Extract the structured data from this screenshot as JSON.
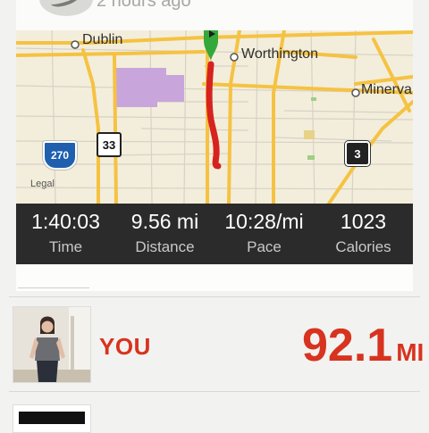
{
  "feed_item": {
    "time_ago": "2 hours ago"
  },
  "map": {
    "labels": {
      "dublin": "Dublin",
      "worthington": "Worthington",
      "minerva": "Minerva",
      "legal": "Legal"
    },
    "shields": {
      "i270": "270",
      "us33": "33",
      "route3": "3"
    },
    "colors": {
      "route": "#d62320",
      "start_pin": "#34a83a",
      "major_road": "#f5c242",
      "minor_road": "#c9c6bd",
      "park": "#c8a6db",
      "land": "#f3eedb"
    }
  },
  "stats": [
    {
      "value": "1:40:03",
      "label": "Time"
    },
    {
      "value": "9.56 mi",
      "label": "Distance"
    },
    {
      "value": "10:28/mi",
      "label": "Pace"
    },
    {
      "value": "1023",
      "label": "Calories"
    }
  ],
  "leaderboard": {
    "user_label": "YOU",
    "distance_value": "92.1",
    "distance_unit": "MI",
    "accent_color": "#d7331f"
  }
}
